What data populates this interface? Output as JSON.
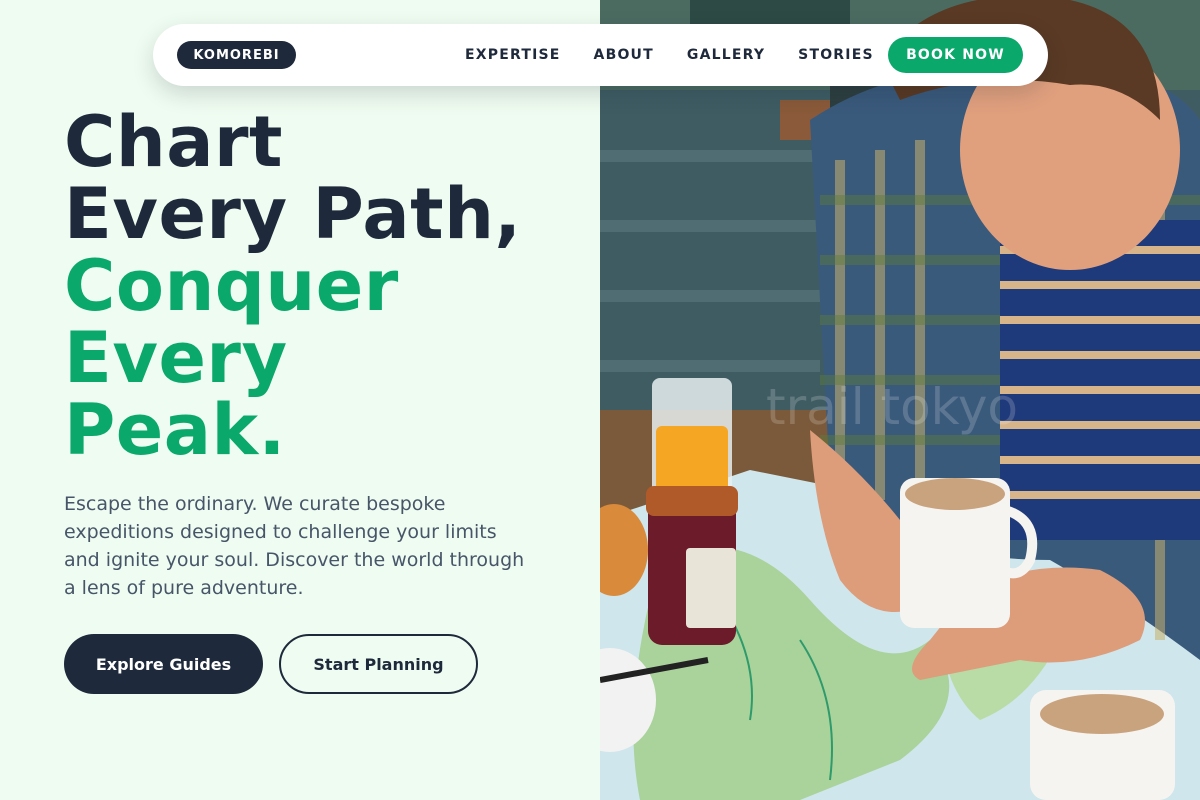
{
  "nav": {
    "logo": "KOMOREBI",
    "links": [
      "EXPERTISE",
      "ABOUT",
      "GALLERY",
      "STORIES"
    ],
    "cta": "BOOK NOW"
  },
  "hero": {
    "headline_dark": [
      "Chart",
      "Every Path,"
    ],
    "headline_green": [
      "Conquer",
      "Every",
      "Peak."
    ],
    "lead": "Escape the ordinary. We curate bespoke expeditions designed to challenge your limits and ignite your soul. Discover the world through a lens of pure adventure.",
    "primary_button": "Explore Guides",
    "secondary_button": "Start Planning"
  },
  "photo": {
    "watermark": "trail tokyo"
  },
  "colors": {
    "accent_green": "#0aa86b",
    "navy": "#1e293b",
    "page_background": "#effcf1",
    "body_text": "#475569"
  }
}
